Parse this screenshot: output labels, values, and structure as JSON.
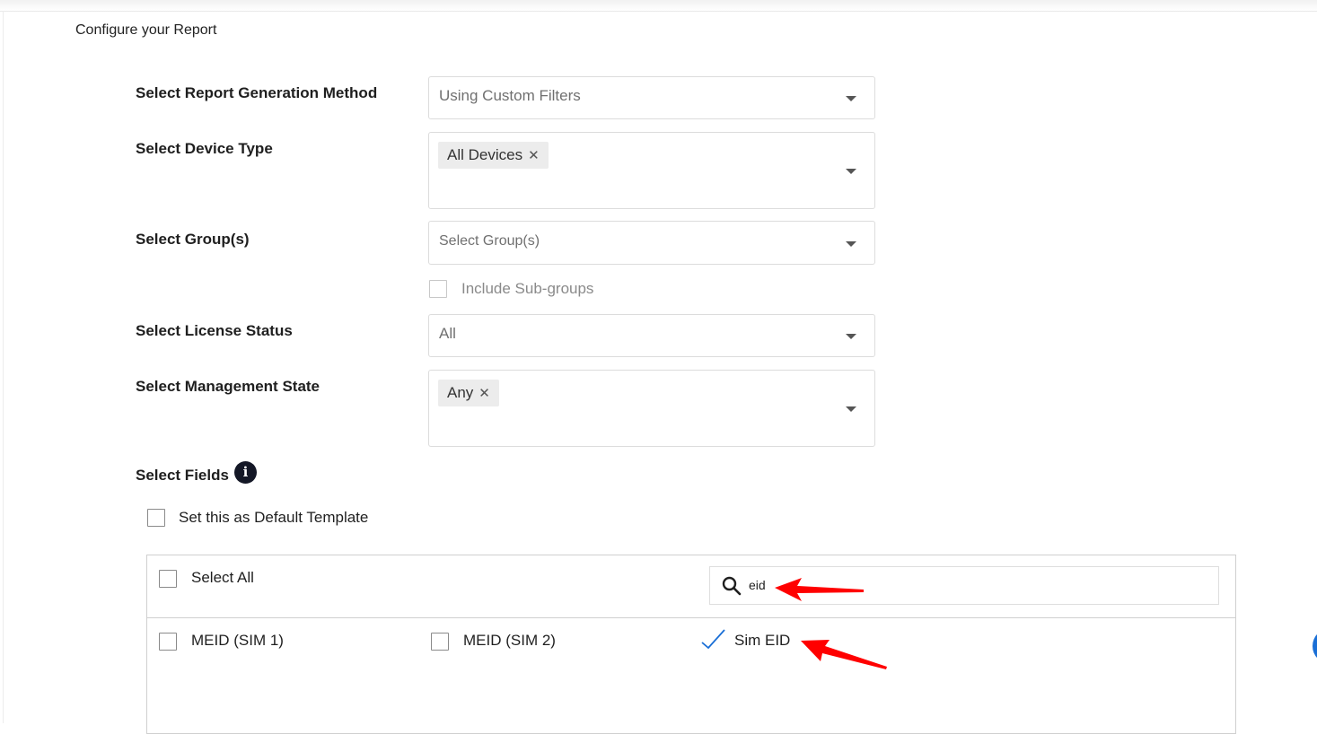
{
  "page": {
    "title": "Configure your Report"
  },
  "form": {
    "generation_method": {
      "label": "Select Report Generation Method",
      "value": "Using Custom Filters"
    },
    "device_type": {
      "label": "Select Device Type",
      "chips": [
        "All Devices"
      ]
    },
    "groups": {
      "label": "Select Group(s)",
      "placeholder": "Select Group(s)",
      "include_subgroups": {
        "label": "Include Sub-groups",
        "checked": false
      }
    },
    "license_status": {
      "label": "Select License Status",
      "value": "All"
    },
    "management_state": {
      "label": "Select Management State",
      "chips": [
        "Any"
      ]
    }
  },
  "fields": {
    "label": "Select Fields",
    "info_icon": "info-icon",
    "default_template": {
      "label": "Set this as Default Template",
      "checked": false
    },
    "select_all": {
      "label": "Select All",
      "checked": false
    },
    "search": {
      "value": "eid",
      "icon": "search-icon"
    },
    "items": [
      {
        "label": "MEID (SIM 1)",
        "checked": false
      },
      {
        "label": "MEID (SIM 2)",
        "checked": false
      },
      {
        "label": "Sim EID",
        "checked": true
      }
    ]
  },
  "colors": {
    "annotation_arrow": "#ff0000",
    "check_mark": "#1a6fd6",
    "info_icon_bg": "#141726"
  }
}
